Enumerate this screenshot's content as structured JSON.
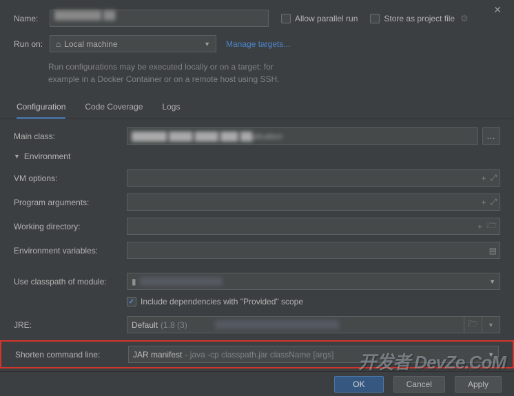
{
  "close_icon": "✕",
  "top": {
    "name_label": "Name:",
    "runon_label": "Run on:",
    "runon_value": "Local machine",
    "manage_targets": "Manage targets...",
    "hint_line1": "Run configurations may be executed locally or on a target: for",
    "hint_line2": "example in a Docker Container or on a remote host using SSH.",
    "allow_parallel": "Allow parallel run",
    "store_as_file": "Store as project file"
  },
  "tabs": {
    "configuration": "Configuration",
    "code_coverage": "Code Coverage",
    "logs": "Logs"
  },
  "form": {
    "main_class": "Main class:",
    "environment": "Environment",
    "vm_options": "VM options:",
    "program_args": "Program arguments:",
    "working_dir": "Working directory:",
    "env_vars": "Environment variables:",
    "use_classpath": "Use classpath of module:",
    "include_provided": "Include dependencies with \"Provided\" scope",
    "jre_label": "JRE:",
    "jre_value_main": "Default",
    "jre_value_dim": "(1.8 (3)",
    "shorten_label": "Shorten command line:",
    "shorten_main": "JAR manifest",
    "shorten_dim": "- java -cp classpath.jar className [args]"
  },
  "footer": {
    "ok": "OK",
    "cancel": "Cancel",
    "apply": "Apply"
  },
  "watermark": "开发者 DevZe.CoM"
}
